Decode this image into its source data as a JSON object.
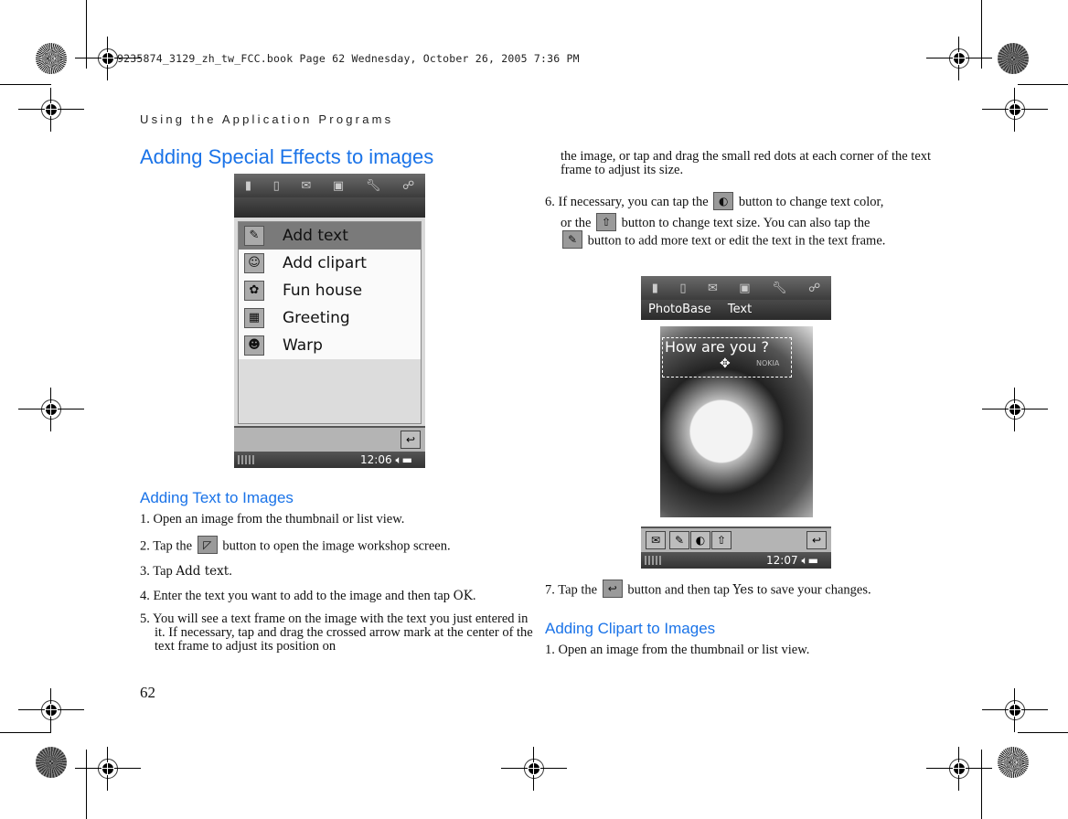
{
  "slug": "9235874_3129_zh_tw_FCC.book  Page 62  Wednesday, October 26, 2005  7:36 PM",
  "running_head": "Using the Application Programs",
  "page_number": "62",
  "section_title": "Adding Special Effects to images",
  "screen1": {
    "top_icons": [
      "phone-icon",
      "doc-icon",
      "mail-icon",
      "calendar-icon",
      "wrench-icon",
      "connect-icon"
    ],
    "menu_items": [
      {
        "label": "Add text",
        "icon": "add-text-icon",
        "selected": true
      },
      {
        "label": "Add clipart",
        "icon": "add-clipart-icon",
        "selected": false
      },
      {
        "label": "Fun house",
        "icon": "fun-house-icon",
        "selected": false
      },
      {
        "label": "Greeting",
        "icon": "greeting-icon",
        "selected": false
      },
      {
        "label": "Warp",
        "icon": "warp-icon",
        "selected": false
      }
    ],
    "back_glyph": "↩",
    "time": "12:06"
  },
  "subsection1": {
    "title": "Adding Text to Images",
    "steps": {
      "s1": "1. Open an image from the thumbnail or list view.",
      "s2_pre": "2. Tap the",
      "s2_post": "button to open the image workshop screen.",
      "s3_pre": "3. Tap ",
      "s3_bold": "Add text",
      "s3_post": ".",
      "s4_pre": "4. Enter the text you want to add to the image and then tap ",
      "s4_bold": "OK",
      "s4_post": ".",
      "s5": "5. You will see a text frame on the image with the text you just entered in it. If necessary, tap and drag the crossed arrow mark at the center of the text frame to adjust its position on",
      "s5_cont": "the image, or tap and drag the small red dots at each corner of the text frame to adjust its size.",
      "s6_a": "6. If necessary, you can tap the",
      "s6_b": "button to change text color,",
      "s6_c": "or the",
      "s6_d": "button to change text size. You can also tap the",
      "s6_e": "button to add more text or edit the text in the text frame.",
      "s7_pre": "7. Tap the",
      "s7_mid": "button and then tap ",
      "s7_bold": "Yes",
      "s7_post": " to save your changes."
    },
    "inline_icons": {
      "workshop": "◸",
      "color": "◐",
      "size": "⇧",
      "edit": "✎",
      "back": "↩"
    }
  },
  "screen2": {
    "title_items": [
      "PhotoBase",
      "Text"
    ],
    "photo_text": "How are you ?",
    "photo_watermark": "NOKIA",
    "move_glyph": "✥",
    "toolbar_glyphs": [
      "✉",
      "✎",
      "◐",
      "⇧"
    ],
    "back_glyph": "↩",
    "time": "12:07"
  },
  "subsection2": {
    "title": "Adding Clipart to Images",
    "s1": "1. Open an image from the thumbnail or list view."
  }
}
